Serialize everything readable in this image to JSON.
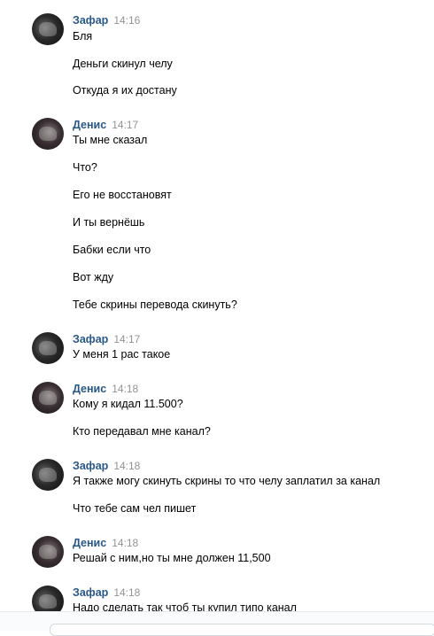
{
  "messages": [
    {
      "author": "Зафар",
      "time": "14:16",
      "lines": [
        "Бля",
        "Деньги скинул челу",
        "Откуда я их достану"
      ]
    },
    {
      "author": "Денис",
      "time": "14:17",
      "lines": [
        "Ты мне сказал",
        "Что?",
        "Его не восстановят",
        "И ты вернёшь",
        "Бабки если что",
        "Вот жду",
        "Тебе скрины перевода скинуть?"
      ]
    },
    {
      "author": "Зафар",
      "time": "14:17",
      "lines": [
        "У меня 1 рас такое"
      ]
    },
    {
      "author": "Денис",
      "time": "14:18",
      "lines": [
        "Кому я кидал 11.500?",
        "Кто передавал мне канал?"
      ]
    },
    {
      "author": "Зафар",
      "time": "14:18",
      "lines": [
        "Я также могу скинуть скрины то что челу заплатил за канал",
        "Что тебе сам чел пишет"
      ]
    },
    {
      "author": "Денис",
      "time": "14:18",
      "lines": [
        "Решай с ним,но ты мне должен 11,500"
      ]
    },
    {
      "author": "Зафар",
      "time": "14:18",
      "lines": [
        "Надо сделать так чтоб ты купил типо канал"
      ]
    }
  ]
}
